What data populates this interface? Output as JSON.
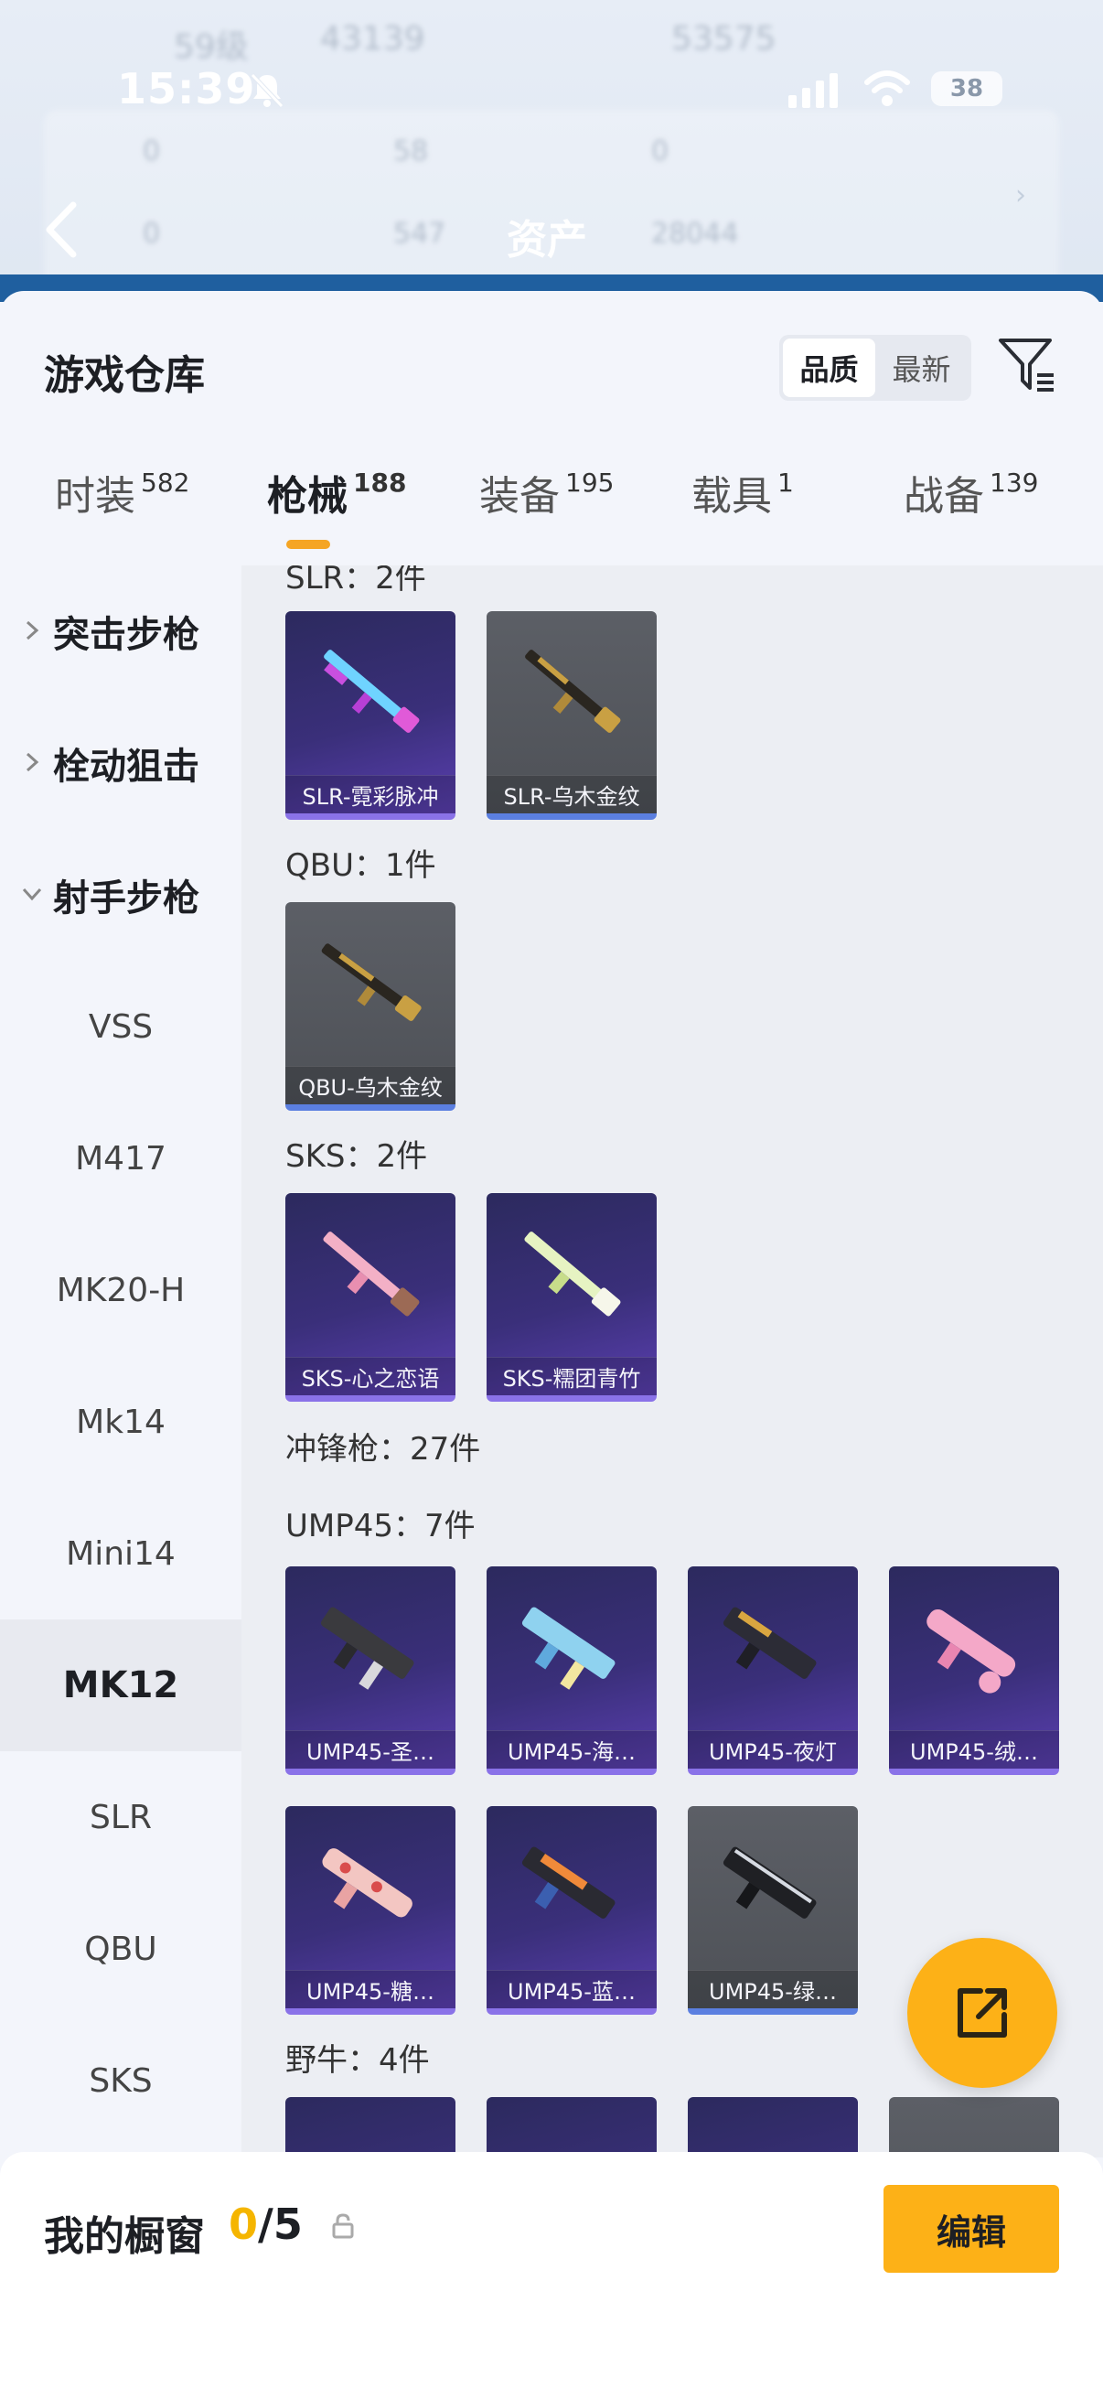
{
  "status_bar": {
    "time": "15:39",
    "battery": "38"
  },
  "background": {
    "level_text": "59级",
    "coins_a": "43139",
    "coins_b": "53575",
    "stats": [
      "0",
      "58",
      "0",
      "0",
      "547",
      "28044"
    ],
    "asset_title": "资产"
  },
  "sheet": {
    "title": "游戏仓库",
    "sort": {
      "options": [
        "品质",
        "最新"
      ],
      "active": "品质"
    },
    "tabs": [
      {
        "label": "时装",
        "count": "582"
      },
      {
        "label": "枪械",
        "count": "188"
      },
      {
        "label": "装备",
        "count": "195"
      },
      {
        "label": "载具",
        "count": "1"
      },
      {
        "label": "战备",
        "count": "139"
      }
    ],
    "active_tab": "枪械"
  },
  "sidebar": {
    "groups": [
      "突击步枪",
      "栓动狙击",
      "射手步枪"
    ],
    "items": [
      "VSS",
      "M417",
      "MK20-H",
      "Mk14",
      "Mini14",
      "MK12",
      "SLR",
      "QBU",
      "SKS"
    ],
    "active": "MK12"
  },
  "content": {
    "sections": [
      {
        "title": "SLR：2件",
        "items": [
          "SLR-霓彩脉冲",
          "SLR-乌木金纹"
        ]
      },
      {
        "title": "QBU：1件",
        "items": [
          "QBU-乌木金纹"
        ]
      },
      {
        "title": "SKS：2件",
        "items": [
          "SKS-心之恋语",
          "SKS-糯团青竹"
        ]
      },
      {
        "title": "冲锋枪：27件"
      },
      {
        "title": "UMP45：7件",
        "items": [
          "UMP45-圣…",
          "UMP45-海…",
          "UMP45-夜灯",
          "UMP45-绒…",
          "UMP45-糖…",
          "UMP45-蓝…",
          "UMP45-绿…"
        ]
      },
      {
        "title": "野牛：4件"
      }
    ]
  },
  "bottom": {
    "label": "我的橱窗",
    "current": "0",
    "total": "/5",
    "edit_label": "编辑"
  },
  "colors": {
    "accent": "#fdb117",
    "rare_purple": "#8a72e8",
    "rare_blue": "#5b7fe0"
  }
}
